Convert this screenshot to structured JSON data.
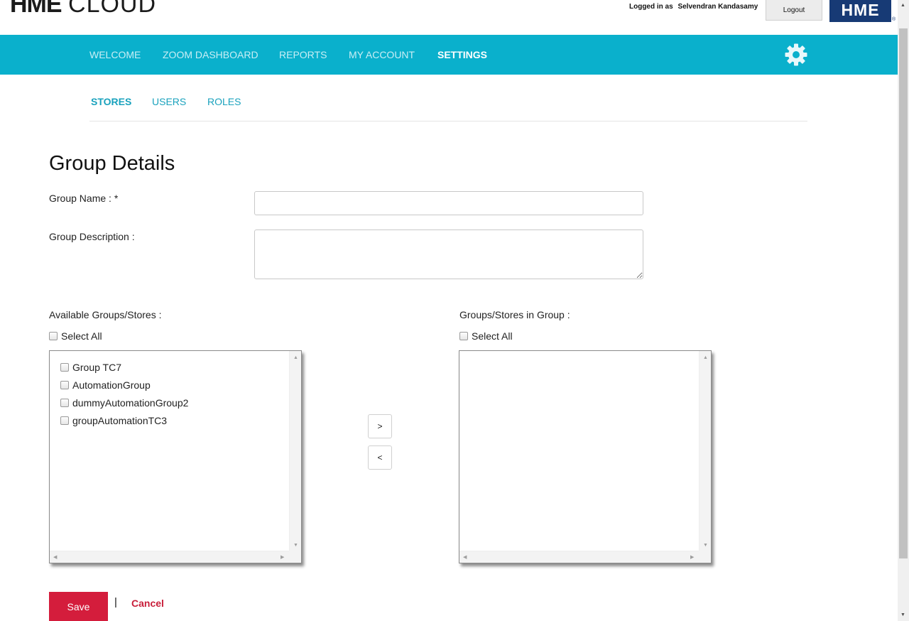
{
  "header": {
    "logo_bold": "HME",
    "logo_light": "CLOUD",
    "logged_in_label": "Logged in as",
    "user_name": "Selvendran Kandasamy",
    "logout_label": "Logout",
    "brand_text": "HME",
    "brand_reg": "®"
  },
  "nav": {
    "items": [
      {
        "label": "WELCOME",
        "active": false
      },
      {
        "label": "ZOOM DASHBOARD",
        "active": false
      },
      {
        "label": "REPORTS",
        "active": false
      },
      {
        "label": "MY ACCOUNT",
        "active": false
      },
      {
        "label": "SETTINGS",
        "active": true
      }
    ],
    "settings_icon": "gear-icon"
  },
  "subnav": {
    "tabs": [
      {
        "label": "STORES",
        "active": true
      },
      {
        "label": "USERS",
        "active": false
      },
      {
        "label": "ROLES",
        "active": false
      }
    ]
  },
  "form": {
    "title": "Group Details",
    "group_name_label": "Group Name : *",
    "group_name_value": "",
    "group_description_label": "Group Description :",
    "group_description_value": ""
  },
  "available": {
    "label": "Available Groups/Stores :",
    "select_all": "Select All",
    "items": [
      "Group TC7",
      "AutomationGroup",
      "dummyAutomationGroup2",
      "groupAutomationTC3"
    ]
  },
  "in_group": {
    "label": "Groups/Stores in Group :",
    "select_all": "Select All",
    "items": []
  },
  "transfer": {
    "add_label": ">",
    "remove_label": "<"
  },
  "footer": {
    "save_label": "Save",
    "separator": "|",
    "cancel_label": "Cancel"
  },
  "colors": {
    "nav_bg": "#0ab0cc",
    "brand_blue": "#173a75",
    "save_red": "#d41d3c",
    "link_teal": "#1aa2bd"
  }
}
